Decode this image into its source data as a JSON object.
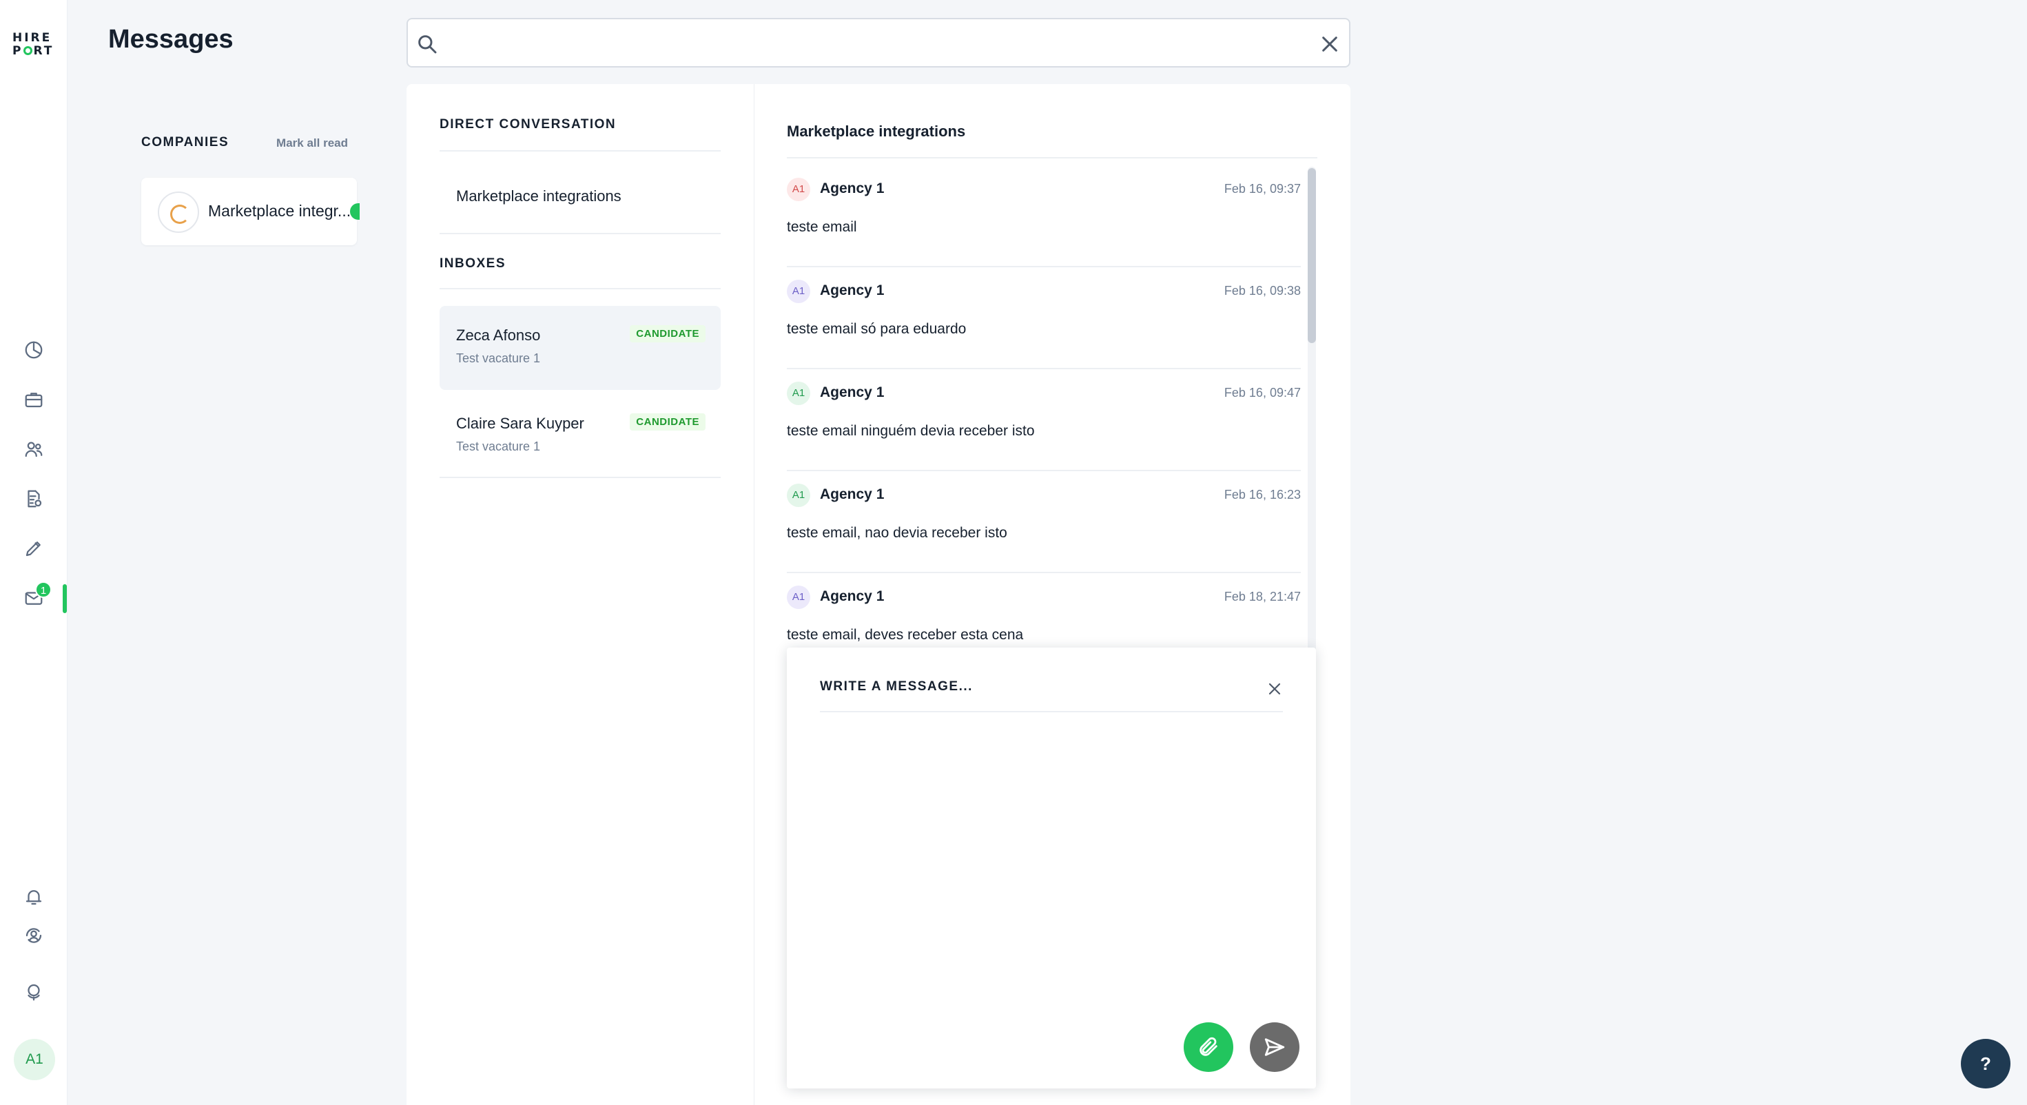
{
  "app": {
    "logo_line1": "HIRE",
    "logo_line2_a": "P",
    "logo_line2_b": "RT",
    "page_title": "Messages"
  },
  "rail": {
    "icons": [
      "dashboard-icon",
      "briefcase-icon",
      "people-icon",
      "report-icon",
      "pencil-icon",
      "mail-icon",
      "bell-icon",
      "user-switch-icon",
      "globe-icon"
    ],
    "mail_badge": "1",
    "avatar_initials": "A1",
    "accent": "#22c55e"
  },
  "search": {
    "value": "",
    "placeholder": ""
  },
  "companies": {
    "label": "COMPANIES",
    "mark_all_read": "Mark all read",
    "items": [
      {
        "name": "Marketplace integr..."
      }
    ]
  },
  "conversations": {
    "direct_label": "DIRECT CONVERSATION",
    "direct_items": [
      {
        "title": "Marketplace integrations"
      }
    ],
    "inboxes_label": "INBOXES",
    "inboxes": [
      {
        "name": "Zeca Afonso",
        "subtitle": "Test vacature 1",
        "tag": "CANDIDATE",
        "selected": true
      },
      {
        "name": "Claire Sara Kuyper",
        "subtitle": "Test vacature 1",
        "tag": "CANDIDATE",
        "selected": false
      }
    ]
  },
  "thread": {
    "title": "Marketplace integrations",
    "messages": [
      {
        "avatar": "A1",
        "avatar_bg": "#fde8e8",
        "avatar_fg": "#d24a4a",
        "sender": "Agency 1",
        "time": "Feb 16, 09:37",
        "body": "teste email"
      },
      {
        "avatar": "A1",
        "avatar_bg": "#ece9fb",
        "avatar_fg": "#6c5fc7",
        "sender": "Agency 1",
        "time": "Feb 16, 09:38",
        "body": "teste email só para eduardo"
      },
      {
        "avatar": "A1",
        "avatar_bg": "#e4f6ea",
        "avatar_fg": "#1f9a4d",
        "sender": "Agency 1",
        "time": "Feb 16, 09:47",
        "body": "teste email ninguém devia receber isto"
      },
      {
        "avatar": "A1",
        "avatar_bg": "#e4f6ea",
        "avatar_fg": "#1f9a4d",
        "sender": "Agency 1",
        "time": "Feb 16, 16:23",
        "body": "teste email, nao devia receber isto"
      },
      {
        "avatar": "A1",
        "avatar_bg": "#ece9fb",
        "avatar_fg": "#6c5fc7",
        "sender": "Agency 1",
        "time": "Feb 18, 21:47",
        "body": "teste email, deves receber esta cena"
      }
    ]
  },
  "composer": {
    "title": "WRITE A MESSAGE...",
    "value": "",
    "attach_color": "#22c55e",
    "send_color": "#6b6b6b"
  },
  "help": {
    "label": "?"
  }
}
